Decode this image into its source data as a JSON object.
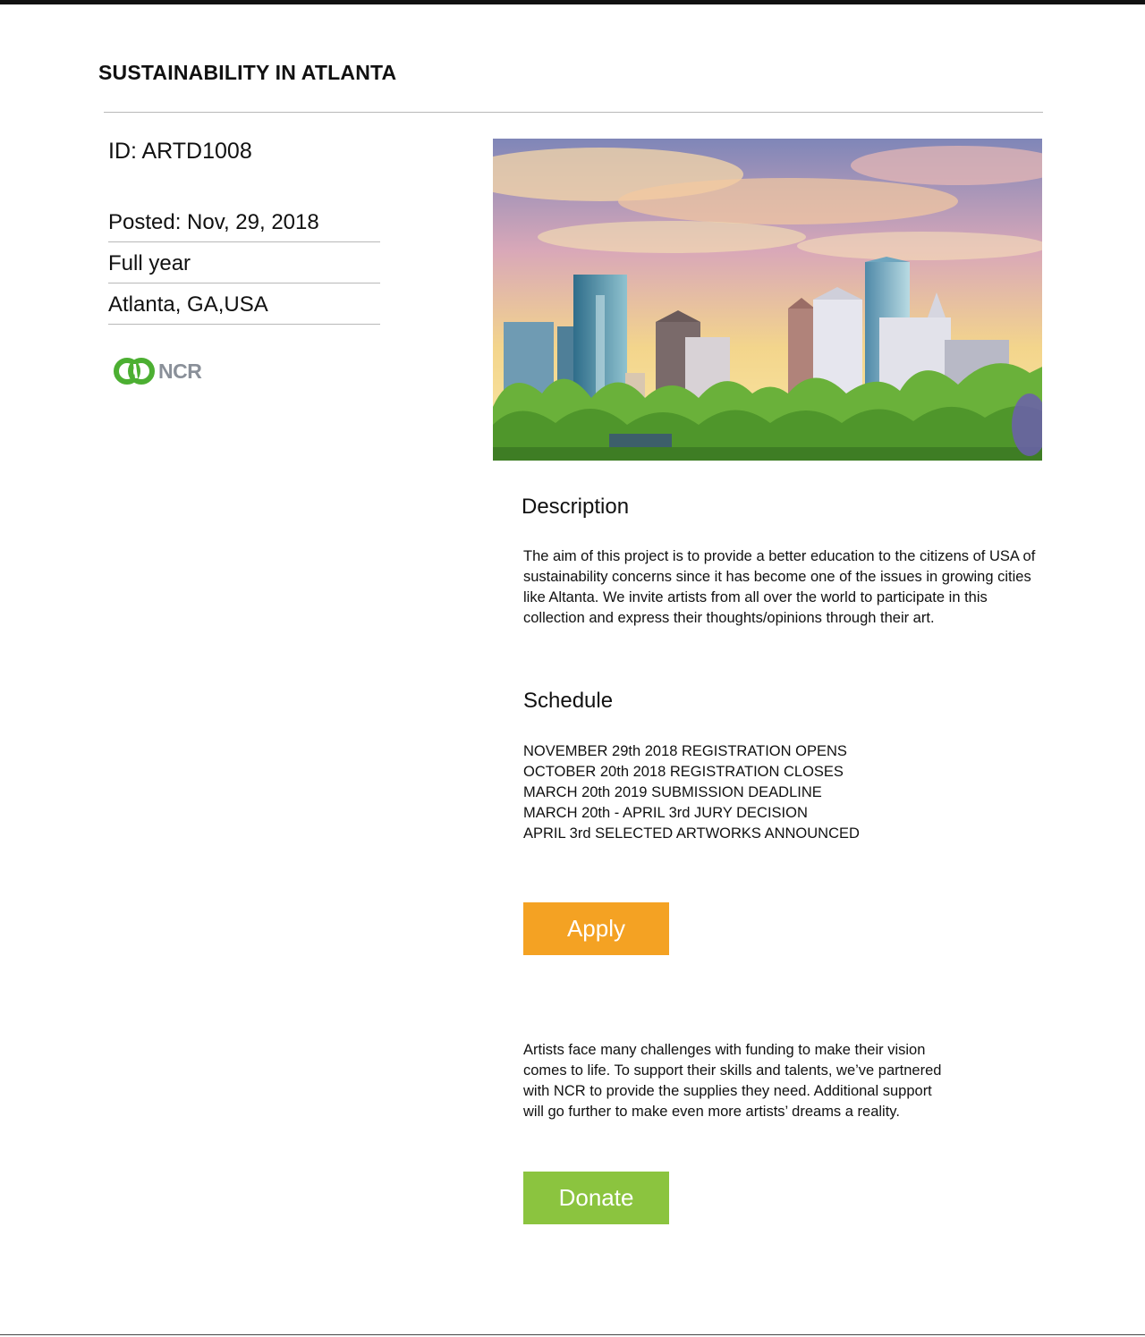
{
  "page": {
    "title": "SUSTAINABILITY IN ATLANTA"
  },
  "project": {
    "id_label": "ID: ARTD1008",
    "meta": [
      "Posted: Nov, 29, 2018",
      "Full year",
      "Atlanta, GA,USA"
    ],
    "sponsor_logo_text": "NCR",
    "hero_image_icon": "atlanta-skyline-photo"
  },
  "description": {
    "heading": "Description",
    "lines": [
      "The aim of this project is to provide a better education to the citizens of USA of",
      "sustainability concerns since it has become one of the issues in growing cities",
      "like Altanta.  We invite artists from all over the world to participate in this",
      "collection and express their thoughts/opinions through their art."
    ]
  },
  "schedule": {
    "heading": "Schedule",
    "items": [
      "NOVEMBER 29th 2018 REGISTRATION OPENS",
      "OCTOBER 20th 2018 REGISTRATION CLOSES",
      "MARCH 20th 2019 SUBMISSION DEADLINE",
      "MARCH 20th - APRIL 3rd JURY DECISION",
      "APRIL 3rd SELECTED ARTWORKS ANNOUNCED"
    ]
  },
  "actions": {
    "apply_label": "Apply",
    "donate_label": "Donate"
  },
  "support": {
    "lines": [
      "Artists face many challenges with funding to make their vision",
      "comes to life. To support their skills and talents, we’ve partnered",
      "with NCR to provide the supplies they need. Additional support",
      "will go further to make even more artists’ dreams a reality."
    ]
  },
  "colors": {
    "apply": "#f4a223",
    "donate": "#8bc43f",
    "ncr_green": "#4caf32",
    "ncr_gray": "#8a9099"
  }
}
